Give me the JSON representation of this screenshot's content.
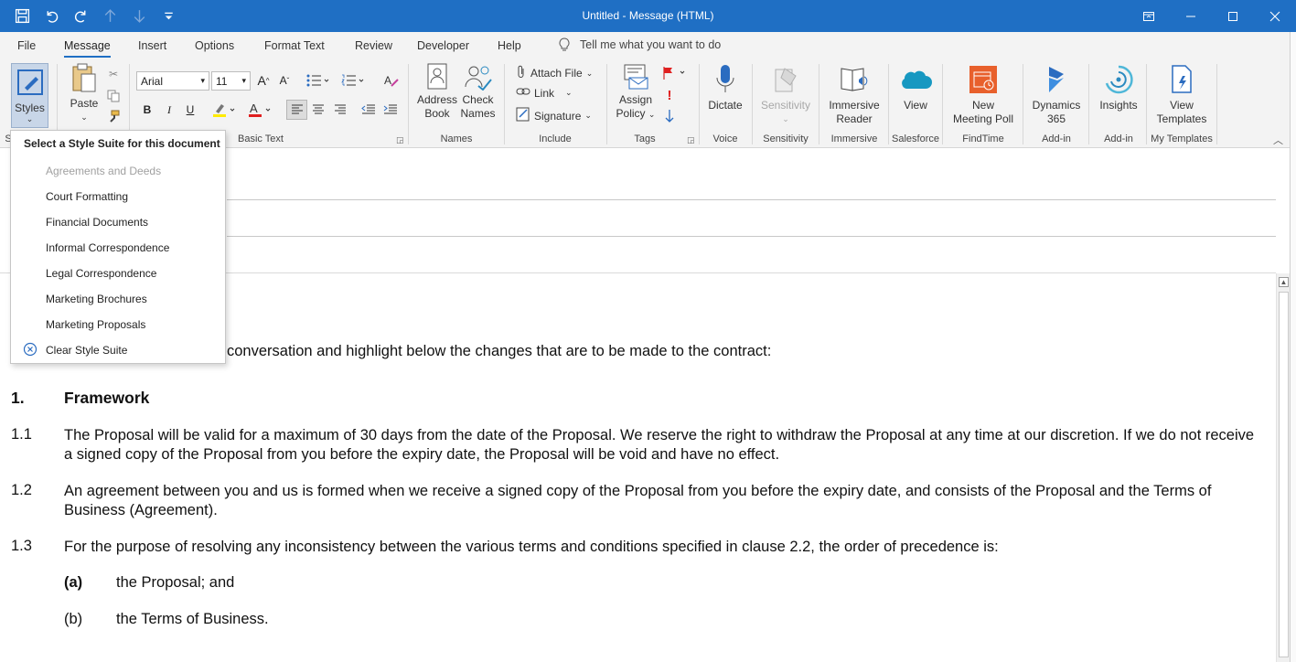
{
  "window": {
    "title": "Untitled  -  Message (HTML)"
  },
  "tabs": [
    {
      "label": "File"
    },
    {
      "label": "Message",
      "active": true
    },
    {
      "label": "Insert"
    },
    {
      "label": "Options"
    },
    {
      "label": "Format Text"
    },
    {
      "label": "Review"
    },
    {
      "label": "Developer"
    },
    {
      "label": "Help"
    }
  ],
  "tellme": {
    "placeholder": "Tell me what you want to do"
  },
  "ribbon": {
    "styles": "Styles",
    "styles_group": "S",
    "clipboard": {
      "paste": "Paste"
    },
    "basic_text": {
      "font": "Arial",
      "size": "11",
      "bold": "B",
      "italic": "I",
      "underline": "U",
      "group_label": "Basic Text"
    },
    "names": {
      "address_book": "Address Book",
      "address_book_1": "Address",
      "address_book_2": "Book",
      "check_names_1": "Check",
      "check_names_2": "Names",
      "group_label": "Names"
    },
    "include": {
      "attach_file": "Attach File",
      "link": "Link",
      "signature": "Signature",
      "group_label": "Include"
    },
    "tags": {
      "assign_1": "Assign",
      "assign_2": "Policy",
      "group_label": "Tags"
    },
    "voice": {
      "dictate": "Dictate",
      "group_label": "Voice"
    },
    "sensitivity": {
      "label": "Sensitivity",
      "group_label": "Sensitivity"
    },
    "immersive": {
      "label_1": "Immersive",
      "label_2": "Reader",
      "group_label": "Immersive"
    },
    "salesforce": {
      "label": "View",
      "group_label": "Salesforce"
    },
    "findtime": {
      "label_1": "New",
      "label_2": "Meeting Poll",
      "group_label": "FindTime"
    },
    "dynamics": {
      "label_1": "Dynamics",
      "label_2": "365",
      "group_label": "Add-in"
    },
    "insights": {
      "label": "Insights",
      "group_label": "Add-in"
    },
    "templates": {
      "label_1": "View",
      "label_2": "Templates",
      "group_label": "My Templates"
    }
  },
  "dropdown": {
    "header": "Select a Style Suite for this document",
    "items": [
      {
        "label": "Agreements and Deeds",
        "disabled": true
      },
      {
        "label": "Court Formatting"
      },
      {
        "label": "Financial Documents"
      },
      {
        "label": "Informal Correspondence"
      },
      {
        "label": "Legal Correspondence"
      },
      {
        "label": "Marketing Brochures"
      },
      {
        "label": "Marketing Proposals"
      }
    ],
    "clear": "Clear Style Suite"
  },
  "body": {
    "intro": "conversation and highlight below the changes that are to be made to the contract:",
    "heading_num": "1.",
    "heading": "Framework",
    "clauses": [
      {
        "num": "1.1",
        "text": "The Proposal will be valid for a maximum of 30 days from the date of the Proposal.  We reserve the right to withdraw the Proposal at any time at our discretion.  If we do not receive a signed copy of the Proposal from you before the expiry date, the Proposal will be void and have no effect."
      },
      {
        "num": "1.2",
        "text": "An agreement between you and us is formed when we receive a signed copy of the Proposal from you before the expiry date, and consists of the Proposal and the Terms of Business (Agreement)."
      },
      {
        "num": "1.3",
        "text": "For the purpose of resolving any inconsistency between the various terms and conditions specified in clause 2.2, the order of precedence is:"
      }
    ],
    "subs": [
      {
        "label": "(a)",
        "text": "the Proposal; and"
      },
      {
        "label": "(b)",
        "text": "the Terms of Business."
      }
    ]
  }
}
